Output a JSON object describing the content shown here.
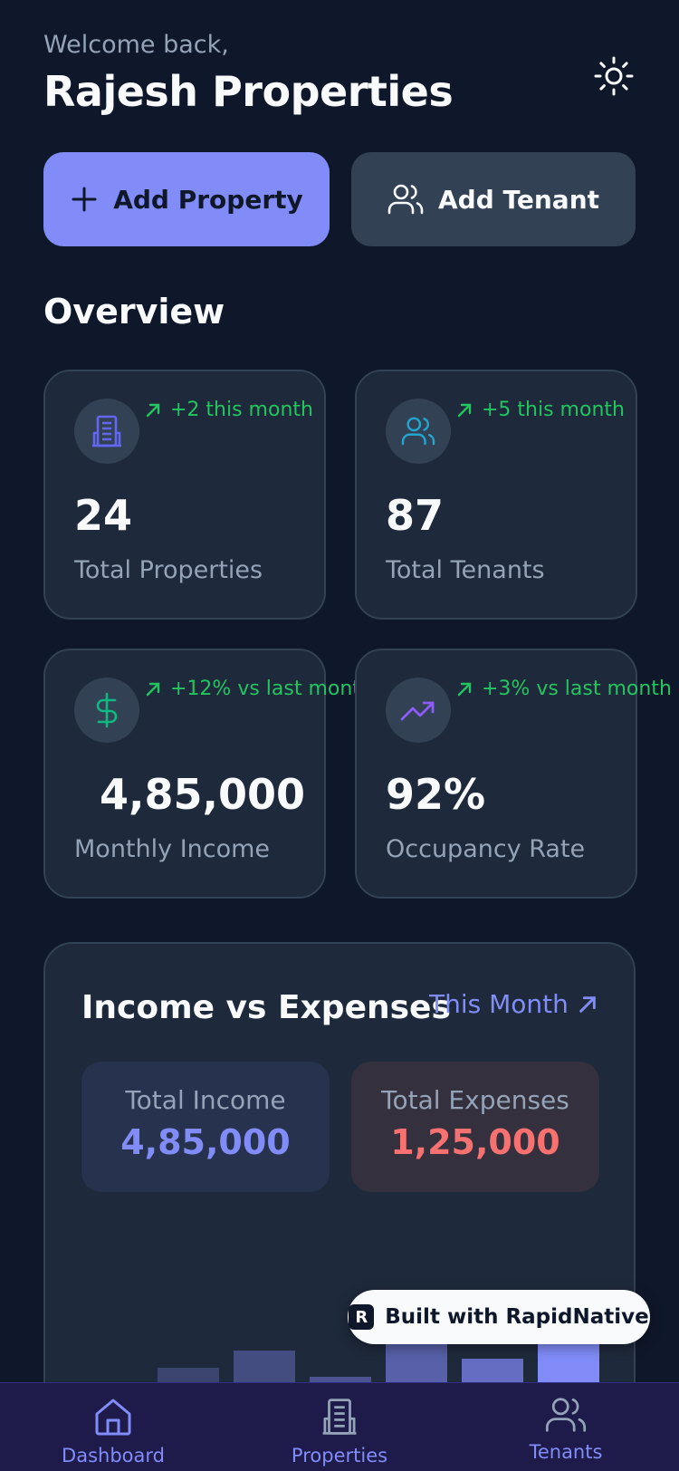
{
  "header": {
    "welcome": "Welcome back,",
    "name": "Rajesh Properties",
    "theme_icon": "sun-icon"
  },
  "actions": {
    "add_property": "Add Property",
    "add_tenant": "Add Tenant"
  },
  "overview": {
    "title": "Overview",
    "cards": [
      {
        "icon": "building-icon",
        "trend": "+2 this month",
        "value": "24",
        "label": "Total Properties"
      },
      {
        "icon": "users-icon",
        "trend": "+5 this month",
        "value": "87",
        "label": "Total Tenants"
      },
      {
        "icon": "dollar-icon",
        "trend": "+12% vs last mont",
        "value": "4,85,000",
        "label": "Monthly Income"
      },
      {
        "icon": "trending-up-icon",
        "trend": "+3% vs last month",
        "value": "92%",
        "label": "Occupancy Rate"
      }
    ]
  },
  "income_expenses": {
    "title": "Income vs Expenses",
    "period": "This Month",
    "total_income_label": "Total Income",
    "total_income_value": "4,85,000",
    "total_expenses_label": "Total Expenses",
    "total_expenses_value": "1,25,000"
  },
  "chart_data": {
    "type": "bar",
    "title": "",
    "xlabel": "",
    "ylabel": "",
    "values": [
      104,
      132,
      151,
      122,
      159,
      142,
      170
    ],
    "colors": [
      "#343e5c",
      "#3b4570",
      "#444d80",
      "#4b5491",
      "#5760a8",
      "#646dc2",
      "#818cf8"
    ]
  },
  "badge": {
    "text": "Built with RapidNative"
  },
  "tabbar": {
    "dashboard": "Dashboard",
    "properties": "Properties",
    "tenants": "Tenants"
  },
  "colors": {
    "background": "#0f172a",
    "card": "#1e293b",
    "accent": "#818cf8",
    "positive": "#22c55e",
    "negative": "#f87171"
  }
}
